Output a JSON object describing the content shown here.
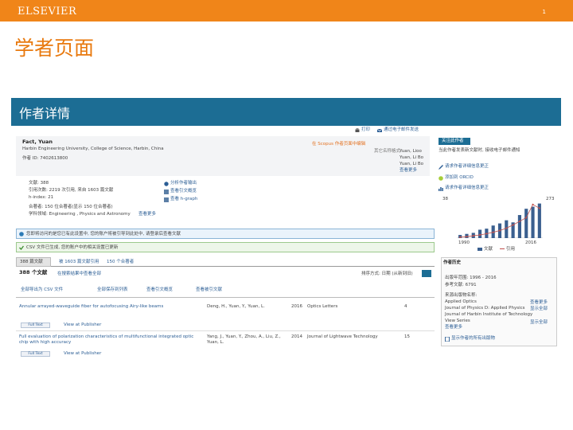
{
  "slide": {
    "logo": "ELSEVIER",
    "page_number": "1",
    "title": "学者页面",
    "brand_color": "#f08519"
  },
  "screenshot": {
    "header": {
      "title": "作者详情",
      "bg": "#1c6d94"
    },
    "top_links": {
      "print": "打印",
      "email": "通过电子邮件发送"
    },
    "author": {
      "name": "Fact, Yuan",
      "affiliation": "Harbin Engineering University, College of Science, Harbin, China",
      "author_id": "作者 ID: 7402613800",
      "follow_link": "在 Scopus 作者页面中编辑",
      "other_name_label": "其它名称格式:",
      "other_names": [
        "Yuan, Lioo",
        "Yuan, Li Bo",
        "Yuan, Li Bo"
      ],
      "more_link": "查看更多"
    },
    "metrics": {
      "docs": "文献: 388",
      "citations": "引用次数: 2219 次引用, 来自 1603 篇文献",
      "h_index": "h-index: 21",
      "coauthors": "合著者: 150 位合著者(显示 150 位合著者)",
      "subjects": "学科领域: Engineering , Physics and Astronomy",
      "subjects_more": "查看更多",
      "links": [
        "分析作者输出",
        "查看引文概览",
        "查看 h-graph"
      ]
    },
    "right_actions": {
      "alert": "关注此作者",
      "alert_note": "当此作者发表新文献时, 接收电子邮件通知",
      "orcid": "添加到 ORCID",
      "feedback": "请求作者详细信息更正"
    },
    "chart_data": {
      "type": "bar",
      "x_range": [
        "1990",
        "2016"
      ],
      "y_left_max": "38",
      "y_right_max": "273",
      "legend": [
        "文献",
        "引用"
      ],
      "bars": [
        3,
        4,
        5,
        8,
        9,
        12,
        14,
        17,
        15,
        22,
        28,
        30,
        33
      ],
      "line": [
        6,
        10,
        16,
        22,
        30,
        40,
        52,
        68,
        90,
        115,
        140,
        230,
        205
      ]
    },
    "banner": {
      "info": "您即将访问的是您已有此设置中, 您的账户将被引导到此处中, 请登录后查看文献",
      "success": "CSV 文件已生成, 您的账户中的相关设置已更新"
    },
    "tabs": [
      "388 篇文献",
      "被 1603 篇文献引用",
      "150 个合著者"
    ],
    "results": {
      "count": "388 个文献",
      "search_link": "在搜索结果中查看全部",
      "sort_label": "排序方式: 日期 (从新到旧)",
      "actions": [
        "全部导出为 CSV 文件",
        "全部保存到列表",
        "查看引文概览",
        "查看被引文献"
      ],
      "rows": [
        {
          "title": "Annular arrayed-waveguide fiber for autofocusing Airy-like beams",
          "authors": "Deng, H., Yuan, Y., Yuan, L.",
          "year": "2016",
          "source": "Optics Letters",
          "cited": "4"
        },
        {
          "title": "Full evaluation of polarization characteristics of multifunctional integrated optic chip with high accuracy",
          "authors": "Yang, J., Yuan, Y., Zhou, A., Liu, Z., Yuan, L.",
          "year": "2014",
          "source": "Journal of Lightwave Technology",
          "cited": "15"
        }
      ],
      "full_text": "Full Text",
      "view_publisher": "View at Publisher"
    },
    "history": {
      "title": "作者历史",
      "range": "出版年范围: 1996 - 2016",
      "refs": "参考文献: 6791",
      "sources_label": "来源出版物名称:",
      "sources": [
        "Applied Optics",
        "Journal of Physics D: Applied Physics",
        "Journal of Harbin Institute of Technology",
        "View Series"
      ],
      "more": "查看更多",
      "view_more_right": [
        "查看更多",
        "显示全部",
        "显示全部"
      ],
      "view_profile": "显示作者的所有出版物"
    }
  }
}
